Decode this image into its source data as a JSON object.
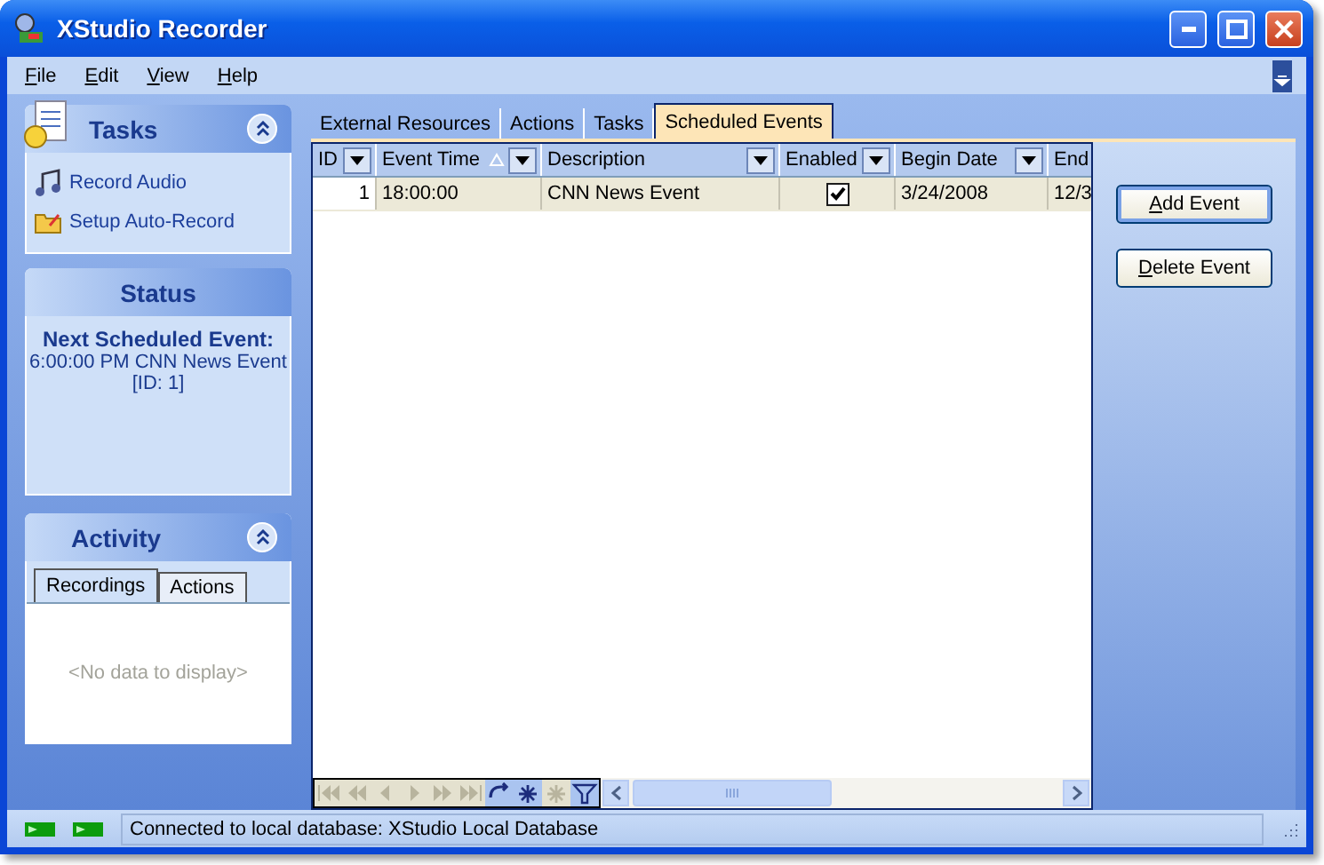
{
  "window": {
    "title": "XStudio Recorder"
  },
  "menu": [
    {
      "label": "File"
    },
    {
      "label": "Edit"
    },
    {
      "label": "View"
    },
    {
      "label": "Help"
    }
  ],
  "tasks": {
    "title": "Tasks",
    "expanded": true,
    "items": [
      {
        "label": "Record Audio",
        "kind": "audio"
      },
      {
        "label": "Setup Auto-Record",
        "kind": "folder"
      }
    ]
  },
  "status_panel": {
    "title": "Status",
    "heading": "Next Scheduled Event:",
    "lines": [
      "6:00:00 PM CNN News Event",
      "[ID: 1]"
    ]
  },
  "activity": {
    "title": "Activity",
    "expanded": true,
    "tabs": [
      {
        "label": "Recordings",
        "selected": true
      },
      {
        "label": "Actions",
        "selected": false
      }
    ],
    "empty_text": "<No data to display>"
  },
  "tabs": [
    {
      "label": "External Resources",
      "selected": false
    },
    {
      "label": "Actions",
      "selected": false
    },
    {
      "label": "Tasks",
      "selected": false
    },
    {
      "label": "Scheduled Events",
      "selected": true
    }
  ],
  "grid": {
    "columns": [
      {
        "label": "ID",
        "sorted": false,
        "filter": true
      },
      {
        "label": "Event Time",
        "sorted": true,
        "filter": true
      },
      {
        "label": "Description",
        "sorted": false,
        "filter": true
      },
      {
        "label": "Enabled",
        "sorted": false,
        "filter": true
      },
      {
        "label": "Begin Date",
        "sorted": false,
        "filter": true
      },
      {
        "label": "End"
      }
    ],
    "rows": [
      {
        "id": "1",
        "event_time": "18:00:00",
        "description": "CNN News Event",
        "enabled": true,
        "begin_date": "3/24/2008",
        "end": "12/3",
        "selected": true
      }
    ],
    "navigator": [
      {
        "kind": "first",
        "disabled": true
      },
      {
        "kind": "prev-page",
        "disabled": true
      },
      {
        "kind": "prev",
        "disabled": true
      },
      {
        "kind": "next",
        "disabled": true
      },
      {
        "kind": "next-page",
        "disabled": true
      },
      {
        "kind": "last",
        "disabled": true
      },
      {
        "kind": "refresh",
        "disabled": false
      },
      {
        "kind": "add",
        "disabled": false
      },
      {
        "kind": "delete",
        "disabled": true
      },
      {
        "kind": "filter",
        "disabled": false
      }
    ]
  },
  "buttons": [
    {
      "label": "Add Event",
      "default": true
    },
    {
      "label": "Delete Event",
      "default": false
    }
  ],
  "status_bar": {
    "indicators": [
      {
        "on": true
      },
      {
        "on": true
      }
    ],
    "text": "Connected to local database: XStudio Local Database"
  }
}
